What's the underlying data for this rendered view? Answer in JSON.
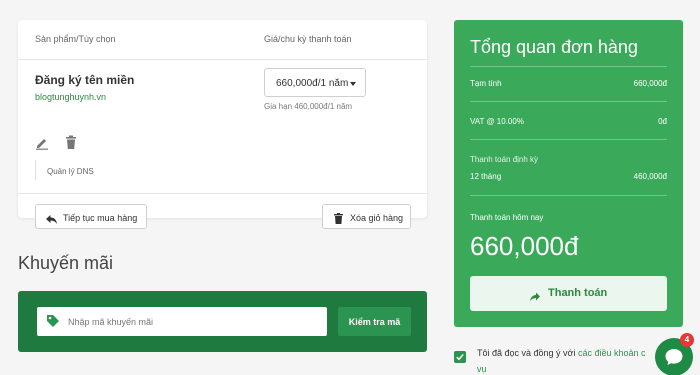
{
  "cart": {
    "col_product": "Sản phẩm/Tùy chọn",
    "col_price": "Giá/chu kỳ thanh toán",
    "item": {
      "name": "Đăng ký tên miền",
      "domain": "blogtunghuynh.vn",
      "dns_label": "Quản lý DNS",
      "price_select": "660,000đ/1 năm",
      "renewal": "Gia hạn 460,000đ/1 năm"
    },
    "continue_label": "Tiếp tục mua hàng",
    "empty_label": "Xóa giỏ hàng"
  },
  "promo": {
    "title": "Khuyến mãi",
    "placeholder": "Nhập mã khuyến mãi",
    "check_label": "Kiểm tra mã"
  },
  "summary": {
    "title": "Tổng quan đơn hàng",
    "subtotal_label": "Tạm tính",
    "subtotal_value": "660,000đ",
    "vat_label": "VAT @ 10.00%",
    "vat_value": "0đ",
    "recurring_label": "Thanh toán định kỳ",
    "recurring_period": "12 tháng",
    "recurring_value": "460,000đ",
    "today_label": "Thanh toán hôm nay",
    "today_value": "660,000đ",
    "checkout_label": "Thanh toán"
  },
  "agree": {
    "text": "Tôi đã đọc và đồng ý với ",
    "link": "các điều khoản c",
    "tail": "vụ"
  },
  "chat": {
    "badge": "4"
  },
  "colors": {
    "accent": "#3aaa5a",
    "dark_green": "#1f7a3f",
    "link_green": "#2a8a3d",
    "badge": "#e53935"
  },
  "icons": [
    "edit-icon",
    "trash-icon",
    "reply-arrow-icon",
    "tag-icon",
    "arrow-right-icon",
    "check-icon",
    "chat-bubble-icon"
  ]
}
